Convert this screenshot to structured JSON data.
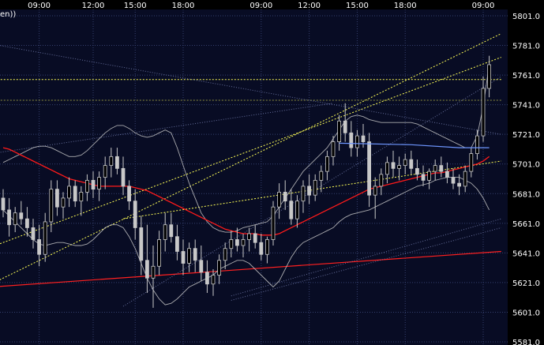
{
  "chart_data": {
    "type": "candlestick",
    "title": "",
    "legend_fragment": "en))",
    "x_tick_labels": [
      "09:00",
      "12:00",
      "15:00",
      "18:00",
      "09:00",
      "12:00",
      "15:00",
      "18:00",
      "09:00"
    ],
    "y_tick_labels": [
      "5801.0",
      "5781.0",
      "5761.0",
      "5741.0",
      "5721.0",
      "5701.0",
      "5681.0",
      "5661.0",
      "5641.0",
      "5621.0",
      "5601.0",
      "5581.0"
    ],
    "ylim": [
      5581,
      5801
    ],
    "grid": true,
    "colors": {
      "background": "#000000",
      "plot_background": "#080c24",
      "grid": "#35406e",
      "candle": "#c8c8c8",
      "moving_average": "#ff1a1a",
      "bollinger": "#c8c8c8",
      "trend_channel": "#ffff55",
      "support_line": "#ff2020",
      "blue_line": "#6e96ff"
    },
    "series": [
      {
        "kind": "candles",
        "ohlc": [
          [
            5678,
            5684,
            5665,
            5670
          ],
          [
            5670,
            5678,
            5652,
            5660
          ],
          [
            5660,
            5672,
            5655,
            5668
          ],
          [
            5668,
            5676,
            5660,
            5664
          ],
          [
            5664,
            5672,
            5652,
            5658
          ],
          [
            5658,
            5664,
            5644,
            5650
          ],
          [
            5650,
            5660,
            5632,
            5640
          ],
          [
            5640,
            5668,
            5635,
            5662
          ],
          [
            5662,
            5690,
            5655,
            5684
          ],
          [
            5684,
            5690,
            5666,
            5672
          ],
          [
            5672,
            5682,
            5664,
            5678
          ],
          [
            5678,
            5692,
            5672,
            5686
          ],
          [
            5686,
            5690,
            5672,
            5676
          ],
          [
            5676,
            5686,
            5666,
            5682
          ],
          [
            5682,
            5694,
            5676,
            5690
          ],
          [
            5690,
            5696,
            5678,
            5684
          ],
          [
            5684,
            5696,
            5676,
            5692
          ],
          [
            5692,
            5706,
            5684,
            5700
          ],
          [
            5700,
            5712,
            5692,
            5706
          ],
          [
            5706,
            5712,
            5694,
            5698
          ],
          [
            5698,
            5706,
            5680,
            5686
          ],
          [
            5686,
            5690,
            5670,
            5676
          ],
          [
            5676,
            5684,
            5650,
            5658
          ],
          [
            5658,
            5666,
            5626,
            5636
          ],
          [
            5636,
            5660,
            5614,
            5624
          ],
          [
            5624,
            5646,
            5604,
            5632
          ],
          [
            5632,
            5656,
            5626,
            5650
          ],
          [
            5650,
            5668,
            5642,
            5660
          ],
          [
            5660,
            5668,
            5648,
            5652
          ],
          [
            5652,
            5660,
            5636,
            5642
          ],
          [
            5642,
            5650,
            5626,
            5634
          ],
          [
            5634,
            5648,
            5628,
            5644
          ],
          [
            5644,
            5650,
            5628,
            5636
          ],
          [
            5636,
            5646,
            5622,
            5628
          ],
          [
            5628,
            5636,
            5614,
            5620
          ],
          [
            5620,
            5630,
            5612,
            5626
          ],
          [
            5626,
            5640,
            5620,
            5636
          ],
          [
            5636,
            5648,
            5630,
            5644
          ],
          [
            5644,
            5656,
            5638,
            5650
          ],
          [
            5650,
            5658,
            5642,
            5646
          ],
          [
            5646,
            5654,
            5638,
            5650
          ],
          [
            5650,
            5658,
            5642,
            5654
          ],
          [
            5654,
            5660,
            5644,
            5648
          ],
          [
            5648,
            5654,
            5636,
            5640
          ],
          [
            5640,
            5652,
            5634,
            5650
          ],
          [
            5650,
            5676,
            5646,
            5672
          ],
          [
            5672,
            5688,
            5664,
            5682
          ],
          [
            5682,
            5690,
            5670,
            5676
          ],
          [
            5676,
            5684,
            5660,
            5664
          ],
          [
            5664,
            5680,
            5658,
            5676
          ],
          [
            5676,
            5690,
            5668,
            5686
          ],
          [
            5686,
            5694,
            5674,
            5680
          ],
          [
            5680,
            5694,
            5676,
            5690
          ],
          [
            5690,
            5700,
            5682,
            5696
          ],
          [
            5696,
            5710,
            5690,
            5706
          ],
          [
            5706,
            5720,
            5700,
            5716
          ],
          [
            5716,
            5734,
            5710,
            5730
          ],
          [
            5730,
            5742,
            5716,
            5722
          ],
          [
            5722,
            5730,
            5706,
            5712
          ],
          [
            5712,
            5724,
            5706,
            5720
          ],
          [
            5720,
            5728,
            5712,
            5716
          ],
          [
            5716,
            5722,
            5672,
            5680
          ],
          [
            5680,
            5692,
            5664,
            5686
          ],
          [
            5686,
            5698,
            5680,
            5694
          ],
          [
            5694,
            5706,
            5688,
            5702
          ],
          [
            5702,
            5710,
            5692,
            5698
          ],
          [
            5698,
            5706,
            5690,
            5700
          ],
          [
            5700,
            5708,
            5694,
            5704
          ],
          [
            5704,
            5710,
            5694,
            5698
          ],
          [
            5698,
            5704,
            5690,
            5694
          ],
          [
            5694,
            5700,
            5686,
            5690
          ],
          [
            5690,
            5698,
            5684,
            5696
          ],
          [
            5696,
            5704,
            5690,
            5700
          ],
          [
            5700,
            5706,
            5692,
            5696
          ],
          [
            5696,
            5702,
            5688,
            5692
          ],
          [
            5692,
            5698,
            5684,
            5688
          ],
          [
            5688,
            5694,
            5680,
            5686
          ],
          [
            5686,
            5700,
            5682,
            5696
          ],
          [
            5696,
            5712,
            5692,
            5708
          ],
          [
            5708,
            5724,
            5704,
            5720
          ],
          [
            5720,
            5760,
            5716,
            5752
          ],
          [
            5752,
            5774,
            5746,
            5768
          ]
        ]
      },
      {
        "kind": "line",
        "role": "moving_average",
        "values": [
          5712,
          5711,
          5709,
          5707,
          5705,
          5703,
          5701,
          5699,
          5697,
          5695,
          5693,
          5691,
          5690,
          5689,
          5688,
          5687,
          5686,
          5686,
          5686,
          5686,
          5686,
          5686,
          5685,
          5684,
          5683,
          5681,
          5679,
          5677,
          5675,
          5673,
          5671,
          5669,
          5667,
          5665,
          5663,
          5661,
          5659,
          5657,
          5656,
          5655,
          5654,
          5654,
          5654,
          5653,
          5653,
          5653,
          5654,
          5656,
          5658,
          5660,
          5662,
          5664,
          5666,
          5668,
          5670,
          5672,
          5674,
          5676,
          5678,
          5680,
          5682,
          5684,
          5685,
          5686,
          5687,
          5688,
          5689,
          5690,
          5691,
          5692,
          5693,
          5694,
          5695,
          5695,
          5696,
          5697,
          5698,
          5699,
          5700,
          5701,
          5703,
          5706
        ]
      },
      {
        "kind": "line",
        "role": "bollinger_upper",
        "values": [
          5702,
          5704,
          5706,
          5708,
          5710,
          5712,
          5713,
          5713,
          5712,
          5710,
          5708,
          5706,
          5706,
          5707,
          5710,
          5714,
          5718,
          5722,
          5725,
          5727,
          5727,
          5725,
          5722,
          5720,
          5719,
          5720,
          5722,
          5724,
          5722,
          5712,
          5700,
          5688,
          5678,
          5668,
          5662,
          5658,
          5656,
          5655,
          5655,
          5656,
          5658,
          5659,
          5660,
          5661,
          5662,
          5666,
          5672,
          5678,
          5684,
          5690,
          5696,
          5700,
          5704,
          5708,
          5712,
          5718,
          5724,
          5730,
          5733,
          5734,
          5733,
          5731,
          5730,
          5729,
          5729,
          5729,
          5729,
          5729,
          5729,
          5728,
          5726,
          5724,
          5722,
          5720,
          5718,
          5716,
          5714,
          5712,
          5712,
          5720,
          5740,
          5768
        ]
      },
      {
        "kind": "line",
        "role": "bollinger_lower",
        "values": [
          5670,
          5666,
          5662,
          5658,
          5654,
          5650,
          5647,
          5646,
          5647,
          5648,
          5648,
          5647,
          5646,
          5646,
          5647,
          5650,
          5654,
          5658,
          5660,
          5660,
          5658,
          5652,
          5644,
          5634,
          5624,
          5616,
          5610,
          5606,
          5607,
          5610,
          5614,
          5618,
          5620,
          5622,
          5624,
          5626,
          5630,
          5632,
          5634,
          5636,
          5636,
          5634,
          5630,
          5626,
          5622,
          5618,
          5622,
          5630,
          5638,
          5644,
          5648,
          5650,
          5652,
          5654,
          5656,
          5658,
          5662,
          5665,
          5667,
          5668,
          5669,
          5670,
          5672,
          5674,
          5676,
          5678,
          5680,
          5682,
          5684,
          5686,
          5687,
          5688,
          5690,
          5691,
          5692,
          5692,
          5692,
          5690,
          5688,
          5684,
          5678,
          5670
        ]
      },
      {
        "kind": "line",
        "role": "blue_line",
        "points": [
          [
            56,
            5715
          ],
          [
            68,
            5714
          ],
          [
            76,
            5712
          ],
          [
            81,
            5712
          ]
        ]
      }
    ],
    "reference_lines": [
      {
        "role": "support_line",
        "from": [
          -2,
          5618
        ],
        "to": [
          83,
          5642
        ]
      },
      {
        "role": "trend_channel",
        "from": [
          -2,
          5620
        ],
        "to": [
          83,
          5789
        ]
      },
      {
        "role": "trend_channel",
        "from": [
          -2,
          5645
        ],
        "to": [
          83,
          5773
        ]
      },
      {
        "role": "trend_channel",
        "from": [
          20,
          5664
        ],
        "to": [
          83,
          5703
        ]
      },
      {
        "role": "trend_channel",
        "from": [
          -2,
          5758
        ],
        "to": [
          83,
          5758
        ]
      },
      {
        "role": "trend_channel",
        "from": [
          -2,
          5744
        ],
        "to": [
          83,
          5744
        ],
        "faint": true
      },
      {
        "role": "faint_line",
        "from": [
          -2,
          5708
        ],
        "to": [
          55,
          5742
        ]
      },
      {
        "role": "faint_line",
        "from": [
          -2,
          5782
        ],
        "to": [
          83,
          5721
        ]
      },
      {
        "role": "faint_line",
        "from": [
          38,
          5612
        ],
        "to": [
          83,
          5664
        ]
      },
      {
        "role": "faint_line",
        "from": [
          38,
          5609
        ],
        "to": [
          83,
          5658
        ]
      },
      {
        "role": "faint_line",
        "from": [
          20,
          5605
        ],
        "to": [
          83,
          5760
        ]
      }
    ]
  }
}
